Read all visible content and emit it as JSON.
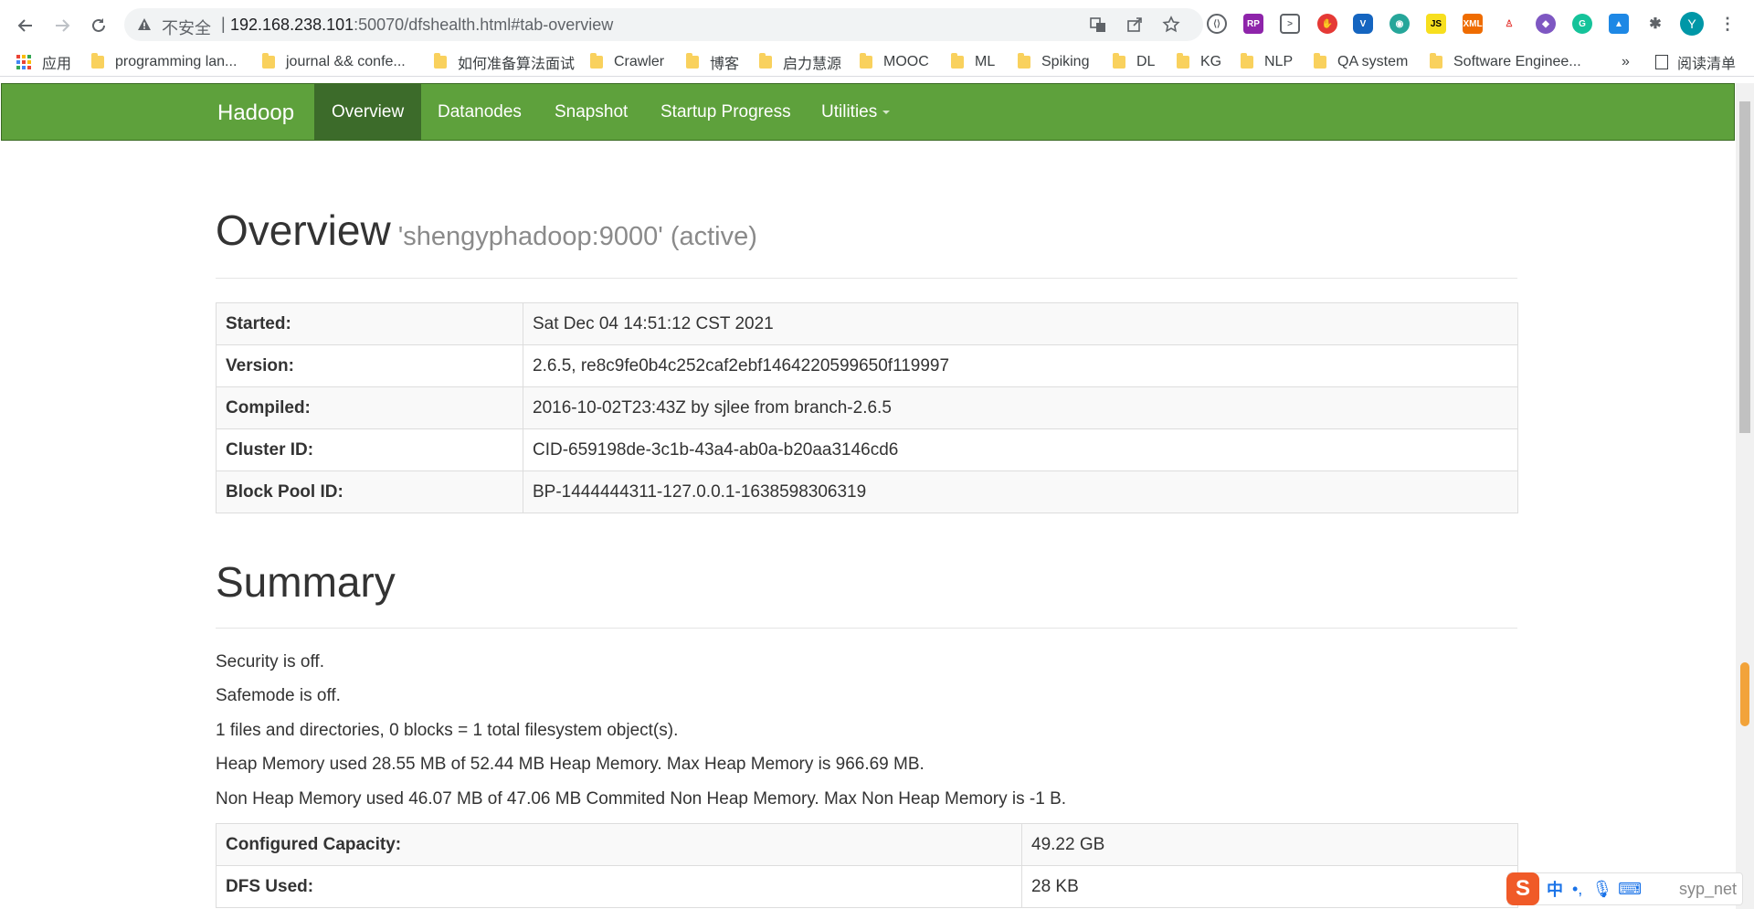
{
  "browser": {
    "insecure_label": "不安全",
    "separator": "|",
    "url_host": "192.168.238.101",
    "url_rest": ":50070/dfshealth.html#tab-overview",
    "profile_initial": "Y"
  },
  "bookmarks": {
    "apps_label": "应用",
    "items": [
      "programming lan...",
      "journal && confe...",
      "如何准备算法面试",
      "Crawler",
      "博客",
      "启力慧源",
      "MOOC",
      "ML",
      "Spiking",
      "DL",
      "KG",
      "NLP",
      "QA system",
      "Software Enginee..."
    ],
    "more": "»",
    "reading_list": "阅读清单"
  },
  "navbar": {
    "brand": "Hadoop",
    "links": [
      "Overview",
      "Datanodes",
      "Snapshot",
      "Startup Progress",
      "Utilities"
    ],
    "active": "Overview"
  },
  "overview": {
    "title": "Overview",
    "subtitle": "'shengyphadoop:9000' (active)",
    "rows": [
      {
        "key": "Started:",
        "value": "Sat Dec 04 14:51:12 CST 2021"
      },
      {
        "key": "Version:",
        "value": "2.6.5, re8c9fe0b4c252caf2ebf1464220599650f119997"
      },
      {
        "key": "Compiled:",
        "value": "2016-10-02T23:43Z by sjlee from branch-2.6.5"
      },
      {
        "key": "Cluster ID:",
        "value": "CID-659198de-3c1b-43a4-ab0a-b20aa3146cd6"
      },
      {
        "key": "Block Pool ID:",
        "value": "BP-1444444311-127.0.0.1-1638598306319"
      }
    ]
  },
  "summary": {
    "title": "Summary",
    "lines": [
      "Security is off.",
      "Safemode is off.",
      "1 files and directories, 0 blocks = 1 total filesystem object(s).",
      "Heap Memory used 28.55 MB of 52.44 MB Heap Memory. Max Heap Memory is 966.69 MB.",
      "Non Heap Memory used 46.07 MB of 47.06 MB Commited Non Heap Memory. Max Non Heap Memory is -1 B."
    ],
    "rows": [
      {
        "key": "Configured Capacity:",
        "value": "49.22 GB"
      },
      {
        "key": "DFS Used:",
        "value": "28 KB"
      }
    ]
  },
  "ime": {
    "logo": "S",
    "mode": "中",
    "punct": "•,",
    "user": "syp_net"
  },
  "colors": {
    "navbar_green": "#5ea13c",
    "navbar_active": "#3c6b2a"
  }
}
